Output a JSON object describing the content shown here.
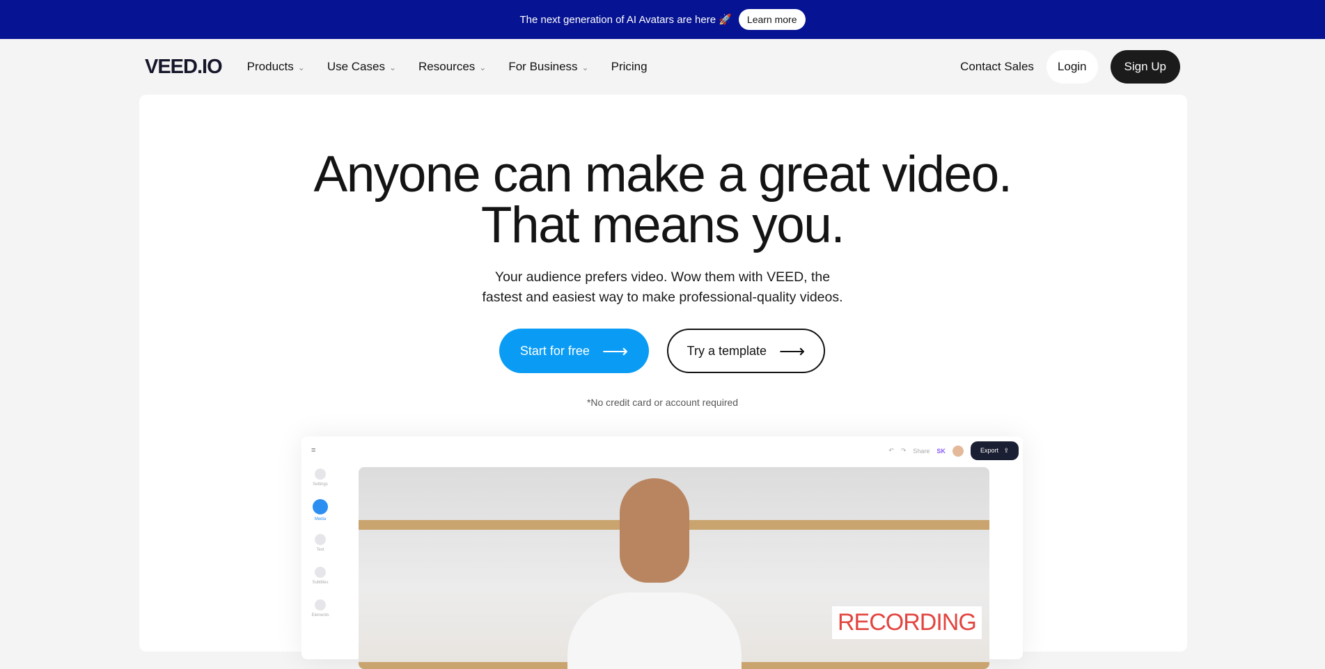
{
  "banner": {
    "text": "The next generation of AI Avatars are here 🚀",
    "button": "Learn more",
    "color": "#061392"
  },
  "nav": {
    "logo": "VEED.IO",
    "items": [
      {
        "label": "Products",
        "dropdown": true
      },
      {
        "label": "Use Cases",
        "dropdown": true
      },
      {
        "label": "Resources",
        "dropdown": true
      },
      {
        "label": "For Business",
        "dropdown": true
      },
      {
        "label": "Pricing",
        "dropdown": false
      }
    ],
    "contact": "Contact Sales",
    "login": "Login",
    "signup": "Sign Up"
  },
  "hero": {
    "line1": "Anyone can make a great video.",
    "line2": "That means you.",
    "sub1": "Your audience prefers video. Wow them with VEED, the",
    "sub2": "fastest and easiest way to make professional-quality videos.",
    "start": "Start for free",
    "template": "Try a template",
    "note": "*No credit card or account required",
    "accent": "#0a9cf5"
  },
  "editor": {
    "sidebar": [
      "Settings",
      "Media",
      "Text",
      "Subtitles",
      "Elements"
    ],
    "share": "Share",
    "avatar_initials": "SK",
    "export": "Export",
    "sign": "RECORDING"
  }
}
